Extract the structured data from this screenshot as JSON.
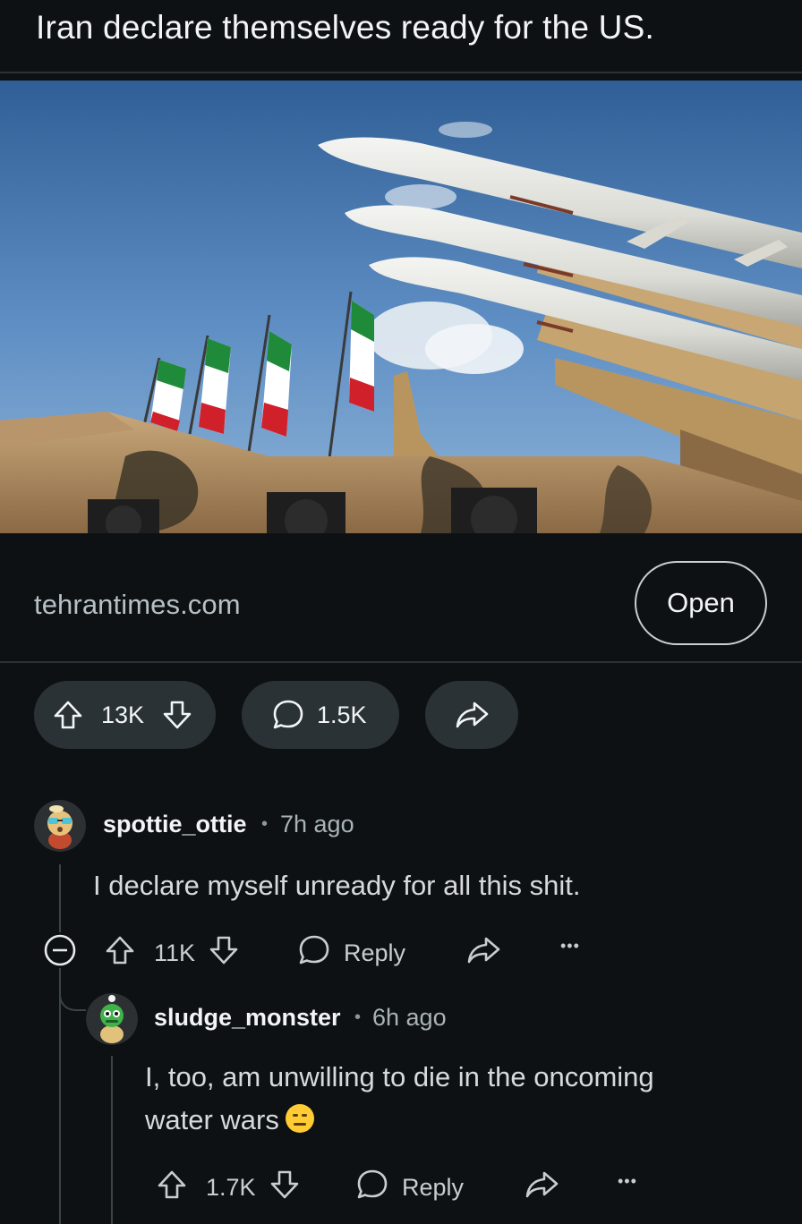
{
  "post": {
    "title": "Iran declare themselves ready for the US.",
    "link_domain": "tehrantimes.com",
    "open_label": "Open",
    "upvotes": "13K",
    "comments": "1.5K"
  },
  "comments": [
    {
      "author": "spottie_ottie",
      "age": "7h ago",
      "body": "I declare myself unready for all this shit.",
      "score": "11K",
      "reply_label": "Reply",
      "more": "•••"
    },
    {
      "author": "sludge_monster",
      "age": "6h ago",
      "body_line1": "I, too, am unwilling to die in the oncoming",
      "body_line2": "water wars",
      "score": "1.7K",
      "reply_label": "Reply",
      "more": "•••"
    }
  ],
  "colors": {
    "background": "#0e1113",
    "pill": "#2a3236",
    "text": "#d7dadc"
  },
  "icons": [
    "upvote-icon",
    "downvote-icon",
    "comment-bubble-icon",
    "share-icon",
    "collapse-icon",
    "more-icon",
    "neutral-face-emoji"
  ]
}
